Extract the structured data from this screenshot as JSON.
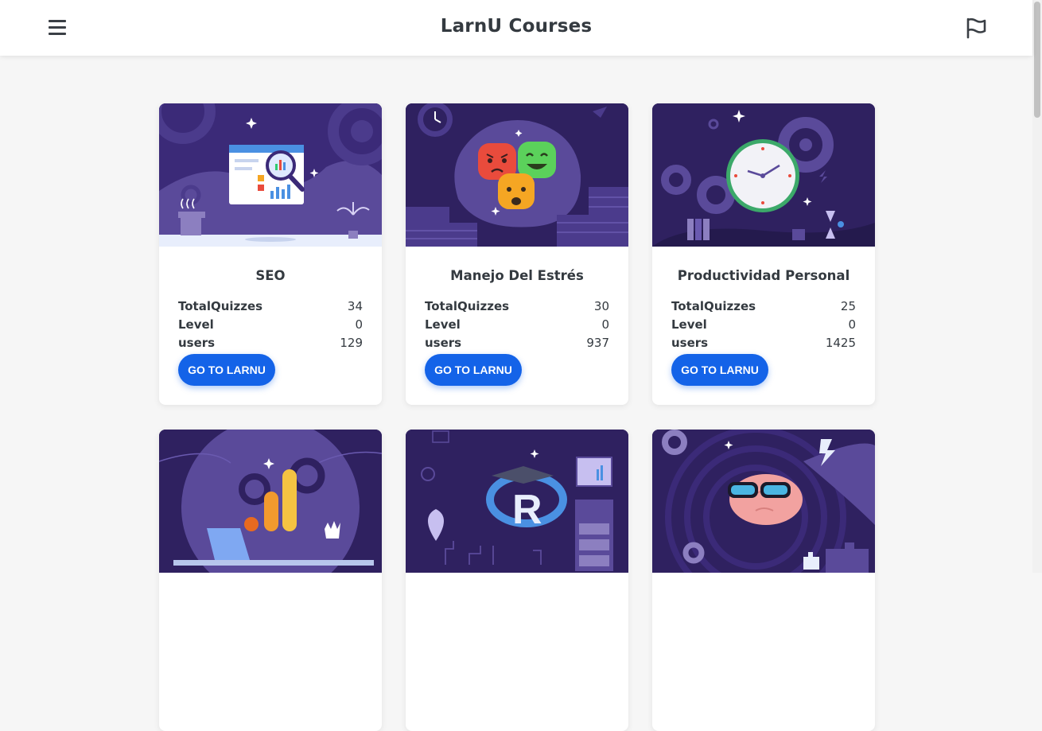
{
  "header": {
    "title": "LarnU Courses",
    "menu_icon": "hamburger-menu-icon",
    "flag_icon": "flag-icon"
  },
  "colors": {
    "accent": "#1463e8",
    "card_illustration_bg": "#2f2160",
    "page_bg": "#f6f6f6"
  },
  "courses": [
    {
      "title": "SEO",
      "illustration": "seo-analytics-illustration",
      "stats": [
        {
          "label": "TotalQuizzes",
          "value": "34"
        },
        {
          "label": "Level",
          "value": "0"
        },
        {
          "label": "users",
          "value": "129"
        }
      ],
      "button_label": "GO TO LARNU"
    },
    {
      "title": "Manejo Del Estrés",
      "illustration": "stress-emotions-illustration",
      "stats": [
        {
          "label": "TotalQuizzes",
          "value": "30"
        },
        {
          "label": "Level",
          "value": "0"
        },
        {
          "label": "users",
          "value": "937"
        }
      ],
      "button_label": "GO TO LARNU"
    },
    {
      "title": "Productividad Personal",
      "illustration": "productivity-clock-illustration",
      "stats": [
        {
          "label": "TotalQuizzes",
          "value": "25"
        },
        {
          "label": "Level",
          "value": "0"
        },
        {
          "label": "users",
          "value": "1425"
        }
      ],
      "button_label": "GO TO LARNU"
    },
    {
      "illustration": "google-analytics-illustration"
    },
    {
      "illustration": "r-programming-illustration"
    },
    {
      "illustration": "brain-glasses-illustration"
    }
  ]
}
